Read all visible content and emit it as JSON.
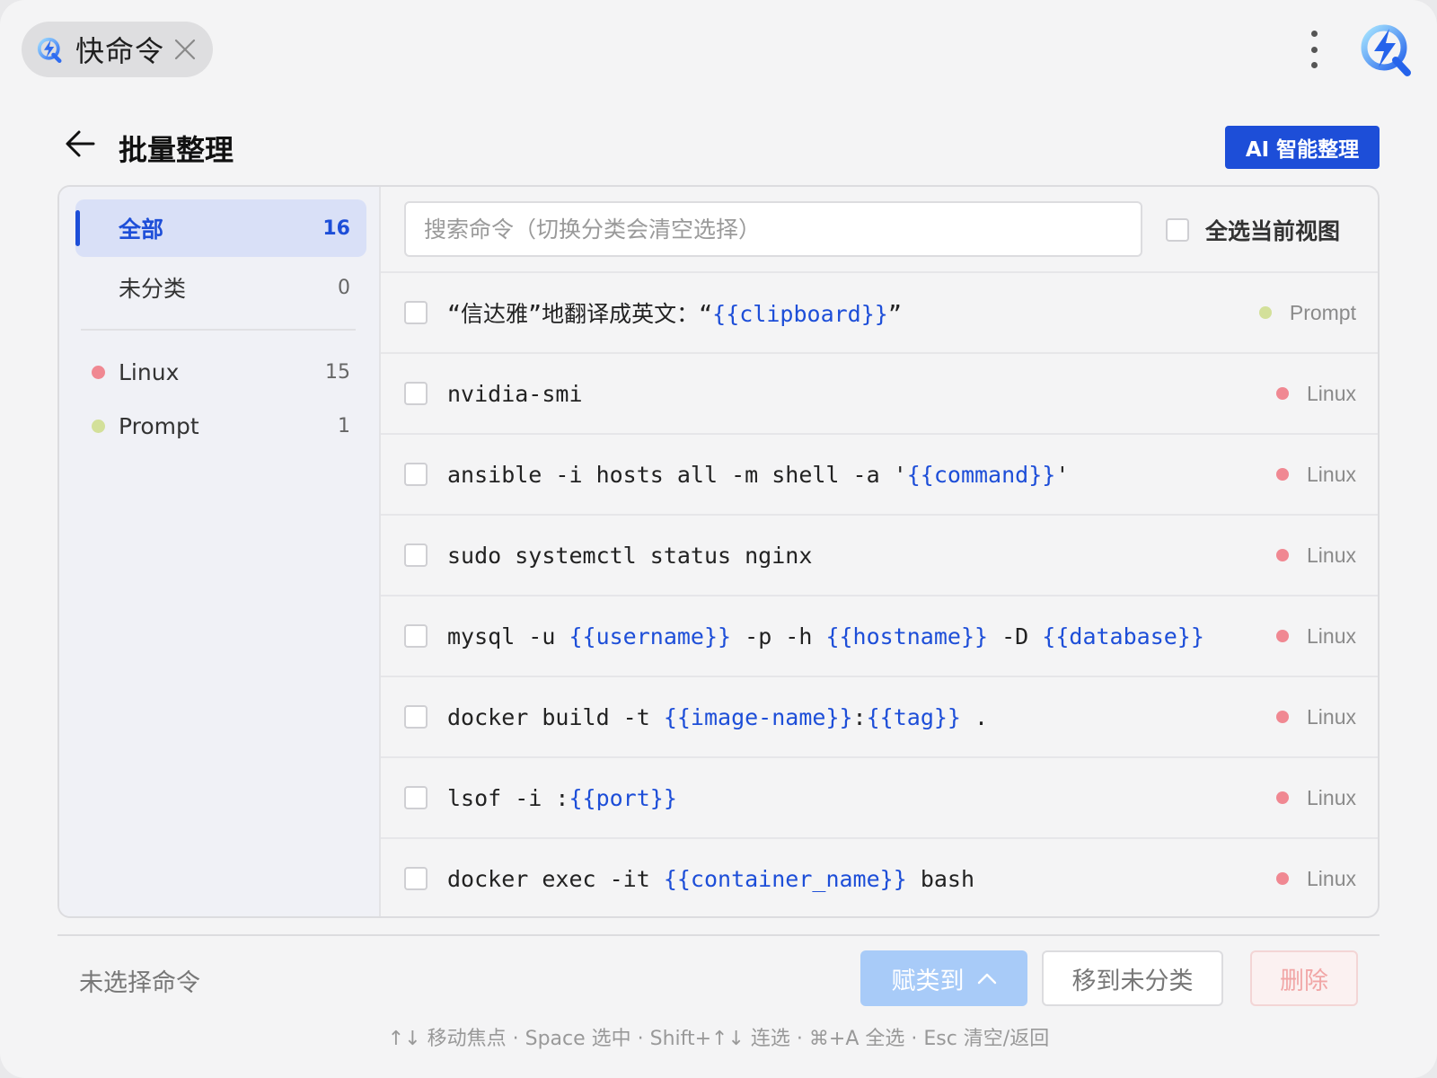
{
  "app": {
    "name": "快命令",
    "icon": "app-logo-icon"
  },
  "header": {
    "title": "批量整理",
    "ai_button": "AI 智能整理"
  },
  "colors": {
    "accent": "#1d4ed8",
    "linux": "#f08892",
    "prompt": "#d3e09a"
  },
  "sidebar": {
    "items": [
      {
        "label": "全部",
        "count": "16",
        "active": true
      },
      {
        "label": "未分类",
        "count": "0"
      },
      {
        "label": "Linux",
        "count": "15",
        "color": "#f08892"
      },
      {
        "label": "Prompt",
        "count": "1",
        "color": "#d3e09a"
      }
    ]
  },
  "search": {
    "placeholder": "搜索命令（切换分类会清空选择）"
  },
  "select_all_label": "全选当前视图",
  "commands": [
    {
      "parts": [
        {
          "t": "“信达雅”地翻译成英文：“"
        },
        {
          "t": "{{clipboard}}",
          "v": true
        },
        {
          "t": "”"
        }
      ],
      "category": "Prompt",
      "color": "#d3e09a"
    },
    {
      "parts": [
        {
          "t": "nvidia-smi"
        }
      ],
      "category": "Linux",
      "color": "#f08892"
    },
    {
      "parts": [
        {
          "t": "ansible -i hosts all -m shell -a '"
        },
        {
          "t": "{{command}}",
          "v": true
        },
        {
          "t": "'"
        }
      ],
      "category": "Linux",
      "color": "#f08892"
    },
    {
      "parts": [
        {
          "t": "sudo systemctl status nginx"
        }
      ],
      "category": "Linux",
      "color": "#f08892"
    },
    {
      "parts": [
        {
          "t": "mysql -u "
        },
        {
          "t": "{{username}}",
          "v": true
        },
        {
          "t": " -p -h "
        },
        {
          "t": "{{hostname}}",
          "v": true
        },
        {
          "t": " -D "
        },
        {
          "t": "{{database}}",
          "v": true
        }
      ],
      "category": "Linux",
      "color": "#f08892"
    },
    {
      "parts": [
        {
          "t": "docker build -t "
        },
        {
          "t": "{{image-name}}",
          "v": true
        },
        {
          "t": ":"
        },
        {
          "t": "{{tag}}",
          "v": true
        },
        {
          "t": " ."
        }
      ],
      "category": "Linux",
      "color": "#f08892"
    },
    {
      "parts": [
        {
          "t": "lsof -i :"
        },
        {
          "t": "{{port}}",
          "v": true
        }
      ],
      "category": "Linux",
      "color": "#f08892"
    },
    {
      "parts": [
        {
          "t": "docker exec -it "
        },
        {
          "t": "{{container_name}}",
          "v": true
        },
        {
          "t": " bash"
        }
      ],
      "category": "Linux",
      "color": "#f08892"
    }
  ],
  "footer": {
    "status": "未选择命令",
    "assign_button": "赋类到",
    "move_button": "移到未分类",
    "delete_button": "删除",
    "hints": "↑↓ 移动焦点 · Space 选中 · Shift+↑↓ 连选 · ⌘+A 全选 · Esc 清空/返回"
  }
}
